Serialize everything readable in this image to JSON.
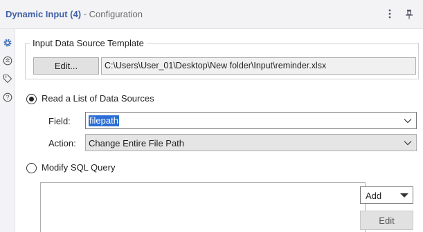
{
  "header": {
    "tool_name": "Dynamic Input (4)",
    "separator": " - ",
    "panel_name": "Configuration",
    "menu_icon": "kebab-menu-icon",
    "pin_icon": "pin-icon"
  },
  "sidebar": {
    "icons": [
      "gear-icon",
      "arrows-icon",
      "tag-icon",
      "help-icon"
    ],
    "active_color": "#3f6fb5"
  },
  "template": {
    "group_title": "Input Data Source Template",
    "edit_label": "Edit...",
    "path_value": "C:\\Users\\User_01\\Desktop\\New folder\\Input\\reminder.xlsx"
  },
  "read_list": {
    "label": "Read a List of Data Sources",
    "selected": true,
    "field_label": "Field:",
    "field_value": "filepath",
    "action_label": "Action:",
    "action_value": "Change Entire File Path"
  },
  "modify_sql": {
    "label": "Modify SQL Query",
    "selected": false,
    "add_label": "Add",
    "edit_label": "Edit"
  },
  "colors": {
    "title_accent": "#3f5fa6",
    "selection": "#2a6ed6"
  }
}
